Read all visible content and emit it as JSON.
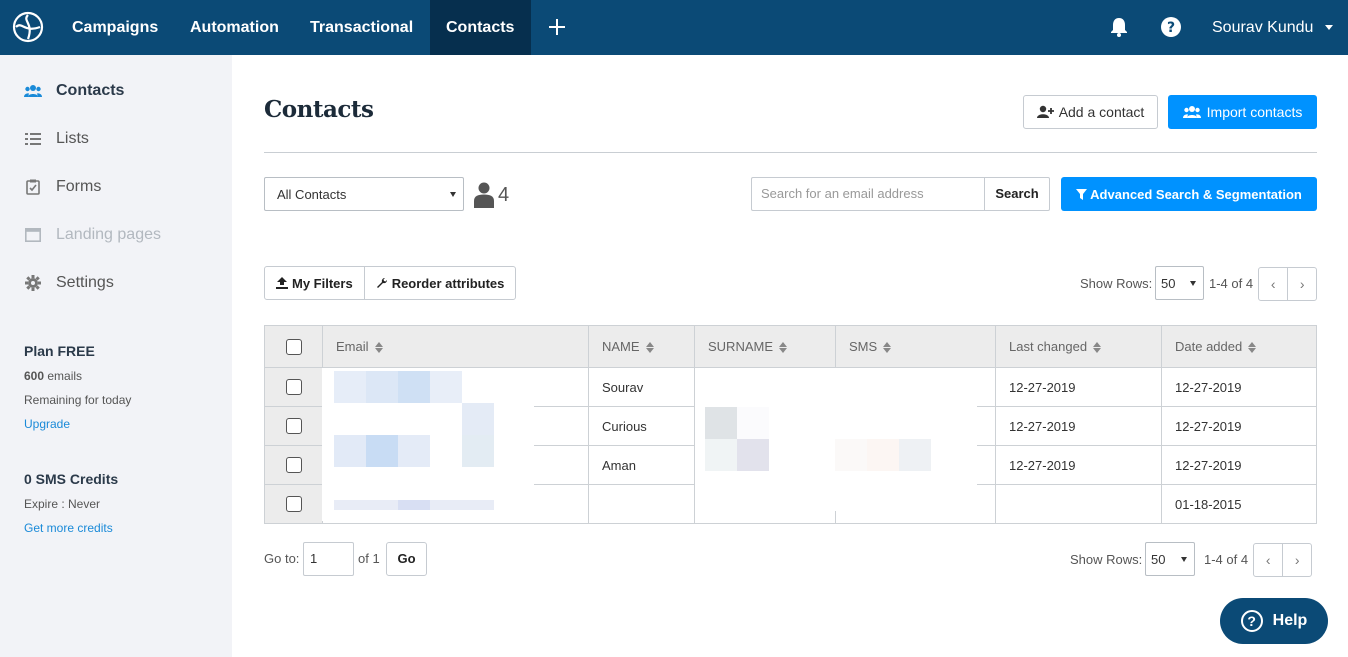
{
  "topnav": {
    "items": [
      {
        "label": "Campaigns",
        "active": false
      },
      {
        "label": "Automation",
        "active": false
      },
      {
        "label": "Transactional",
        "active": false
      },
      {
        "label": "Contacts",
        "active": true
      }
    ],
    "user": "Sourav Kundu",
    "colors": {
      "bar": "#0b4a76",
      "active": "#062f4e"
    }
  },
  "sidebar": {
    "items": [
      {
        "label": "Contacts",
        "icon": "users-icon",
        "state": "active"
      },
      {
        "label": "Lists",
        "icon": "list-icon",
        "state": "normal"
      },
      {
        "label": "Forms",
        "icon": "clipboard-icon",
        "state": "normal"
      },
      {
        "label": "Landing pages",
        "icon": "browser-icon",
        "state": "disabled"
      },
      {
        "label": "Settings",
        "icon": "gear-icon",
        "state": "normal"
      }
    ],
    "plan": {
      "title": "Plan FREE",
      "emails_count": "600",
      "emails_suffix": " emails",
      "remaining": "Remaining for today",
      "upgrade": "Upgrade"
    },
    "sms": {
      "title": "0 SMS Credits",
      "expire": "Expire : Never",
      "link": "Get more credits"
    }
  },
  "main": {
    "title": "Contacts",
    "add_contact": "Add a contact",
    "import_contacts": "Import contacts",
    "list_select": "All Contacts",
    "contact_count": "4",
    "search_placeholder": "Search for an email address",
    "search_button": "Search",
    "advanced_search": "Advanced Search & Segmentation",
    "my_filters": "My Filters",
    "reorder": "Reorder attributes",
    "show_rows_label": "Show Rows:",
    "rows_value": "50",
    "range_text": "1-4 of 4",
    "goto_label": "Go to:",
    "goto_value": "1",
    "of_label": "of 1",
    "go_button": "Go",
    "accent": "#0092ff"
  },
  "table": {
    "columns": [
      "Email",
      "NAME",
      "SURNAME",
      "SMS",
      "Last changed",
      "Date added"
    ],
    "rows": [
      {
        "name": "Sourav",
        "last_changed": "12-27-2019",
        "date_added": "12-27-2019"
      },
      {
        "name": "Curious",
        "last_changed": "12-27-2019",
        "date_added": "12-27-2019"
      },
      {
        "name": "Aman",
        "last_changed": "12-27-2019",
        "date_added": "12-27-2019"
      },
      {
        "name": "",
        "last_changed": "",
        "date_added": "01-18-2015"
      }
    ]
  },
  "help_button": "Help"
}
